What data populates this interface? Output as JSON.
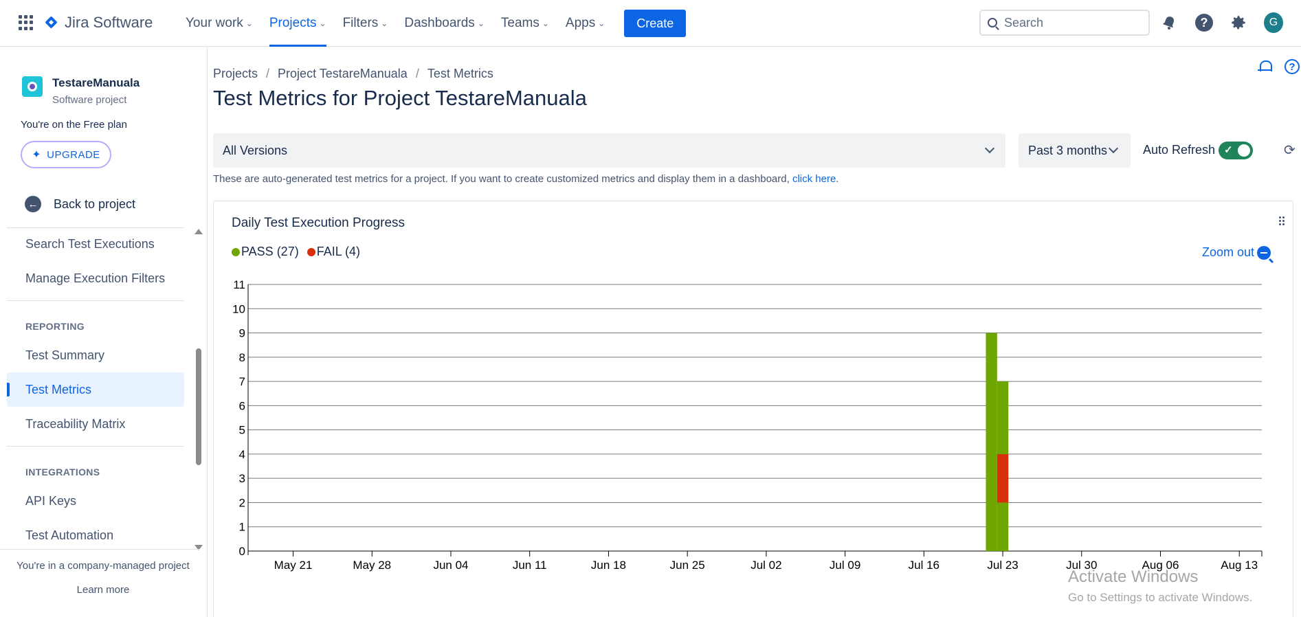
{
  "topnav": {
    "app_name": "Jira Software",
    "items": [
      {
        "label": "Your work",
        "active": false
      },
      {
        "label": "Projects",
        "active": true
      },
      {
        "label": "Filters",
        "active": false
      },
      {
        "label": "Dashboards",
        "active": false
      },
      {
        "label": "Teams",
        "active": false
      },
      {
        "label": "Apps",
        "active": false
      }
    ],
    "create_label": "Create",
    "search_placeholder": "Search",
    "avatar_initial": "G"
  },
  "sidebar": {
    "project_name": "TestareManuala",
    "project_type": "Software project",
    "plan_text": "You're on the Free plan",
    "upgrade_label": "UPGRADE",
    "back_label": "Back to project",
    "items_top": [
      "Search Test Executions",
      "Manage Execution Filters"
    ],
    "reporting_label": "REPORTING",
    "reporting_items": [
      "Test Summary",
      "Test Metrics",
      "Traceability Matrix"
    ],
    "active_item": "Test Metrics",
    "integrations_label": "INTEGRATIONS",
    "integration_items": [
      "API Keys",
      "Test Automation"
    ],
    "footer_text": "You're in a company-managed project",
    "footer_link": "Learn more"
  },
  "main": {
    "breadcrumb": [
      "Projects",
      "Project TestareManuala",
      "Test Metrics"
    ],
    "title": "Test Metrics for Project TestareManuala",
    "version_select": "All Versions",
    "period_select": "Past 3 months",
    "auto_refresh_label": "Auto Refresh",
    "auto_refresh_on": true,
    "info_text": "These are auto-generated test metrics for a project. If you want to create customized metrics and display them in a dashboard,",
    "info_link": "click here",
    "info_after": "."
  },
  "chart_card": {
    "title": "Daily Test Execution Progress",
    "zoom_label": "Zoom out"
  },
  "chart_data": {
    "type": "bar",
    "stacked": true,
    "title": "Daily Test Execution Progress",
    "legend": [
      {
        "label": "PASS (27)",
        "color": "#6fa600"
      },
      {
        "label": "FAIL (4)",
        "color": "#d9300c"
      }
    ],
    "x_ticks": [
      "May 21",
      "May 28",
      "Jun 04",
      "Jun 11",
      "Jun 18",
      "Jun 25",
      "Jul 02",
      "Jul 09",
      "Jul 16",
      "Jul 23",
      "Jul 30",
      "Aug 06",
      "Aug 13"
    ],
    "y_ticks": [
      0,
      1,
      2,
      3,
      4,
      5,
      6,
      7,
      8,
      9,
      10,
      11
    ],
    "ylim": [
      0,
      11
    ],
    "grid": true,
    "x_range": [
      "2024-05-17",
      "2024-08-15"
    ],
    "bars": [
      {
        "date": "2024-07-22",
        "series": [
          {
            "name": "PASS",
            "value": 9
          }
        ]
      },
      {
        "date": "2024-07-23",
        "series": [
          {
            "name": "PASS",
            "value": 2
          },
          {
            "name": "FAIL",
            "value": 2
          },
          {
            "name": "PASS",
            "value": 3
          }
        ]
      }
    ]
  },
  "watermark": {
    "line1": "Activate Windows",
    "line2": "Go to Settings to activate Windows."
  },
  "colors": {
    "accent": "#0c66e4",
    "pass": "#6fa600",
    "fail": "#d9300c",
    "toggle_on": "#1f845a"
  }
}
